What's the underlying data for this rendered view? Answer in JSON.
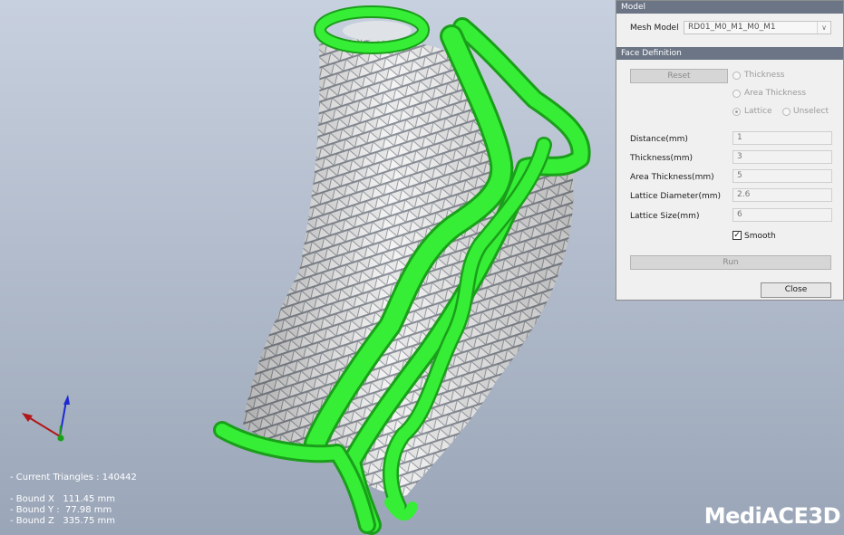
{
  "stats": {
    "current_triangles": "- Current Triangles : 140442",
    "bound_x": "- Bound X   111.45 mm",
    "bound_y": "- Bound Y :  77.98 mm",
    "bound_z": "- Bound Z   335.75 mm"
  },
  "brand": "MediACE3D",
  "panel": {
    "model_header": "Model",
    "mesh_model_label": "Mesh Model",
    "mesh_model_value": "RD01_M0_M1_M0_M1",
    "face_definition_header": "Face Definition",
    "reset_button": "Reset",
    "radios": {
      "thickness": "Thickness",
      "area_thickness": "Area Thickness",
      "lattice": "Lattice",
      "unselect": "Unselect"
    },
    "fields": [
      {
        "label": "Distance(mm)",
        "value": "1"
      },
      {
        "label": "Thickness(mm)",
        "value": "3"
      },
      {
        "label": "Area Thickness(mm)",
        "value": "5"
      },
      {
        "label": "Lattice Diameter(mm)",
        "value": "2.6"
      },
      {
        "label": "Lattice Size(mm)",
        "value": "6"
      }
    ],
    "smooth_label": "Smooth",
    "run_button": "Run",
    "close_button": "Close"
  },
  "colors": {
    "accent_green": "#2ee62e",
    "header_bg": "#6b7585",
    "viewport_top": "#c7d0de",
    "viewport_bottom": "#9aa6b8"
  }
}
